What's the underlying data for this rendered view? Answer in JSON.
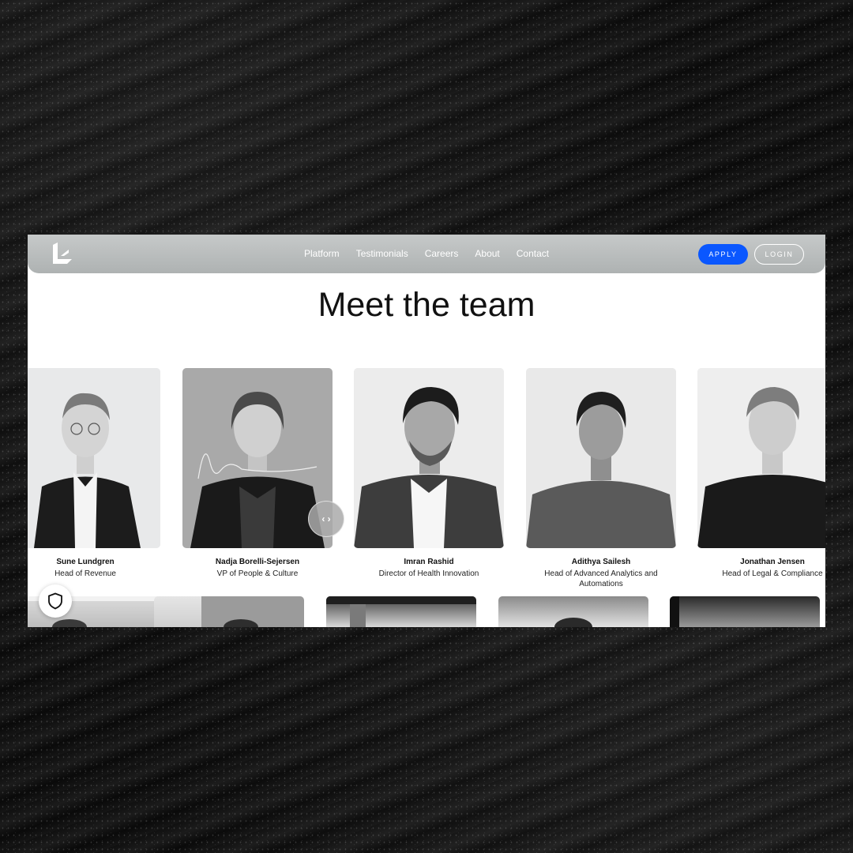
{
  "nav": {
    "links": [
      "Platform",
      "Testimonials",
      "Careers",
      "About",
      "Contact"
    ],
    "apply_label": "APPLY",
    "login_label": "LOGIN",
    "accent_color": "#0a57ff"
  },
  "page": {
    "title": "Meet the team"
  },
  "team": [
    {
      "name": "Sune Lundgren",
      "role": "Head of Revenue"
    },
    {
      "name": "Nadja Borelli-Sejersen",
      "role": "VP of People & Culture"
    },
    {
      "name": "Imran Rashid",
      "role": "Director of Health Innovation"
    },
    {
      "name": "Adithya Sailesh",
      "role": "Head of Advanced Analytics and Automations"
    },
    {
      "name": "Jonathan Jensen",
      "role": "Head of Legal & Compliance"
    }
  ],
  "slider_handle": {
    "icon": "chevron-left-right-icon",
    "glyph": "‹ ›"
  },
  "privacy_button": {
    "icon": "shield-icon"
  }
}
